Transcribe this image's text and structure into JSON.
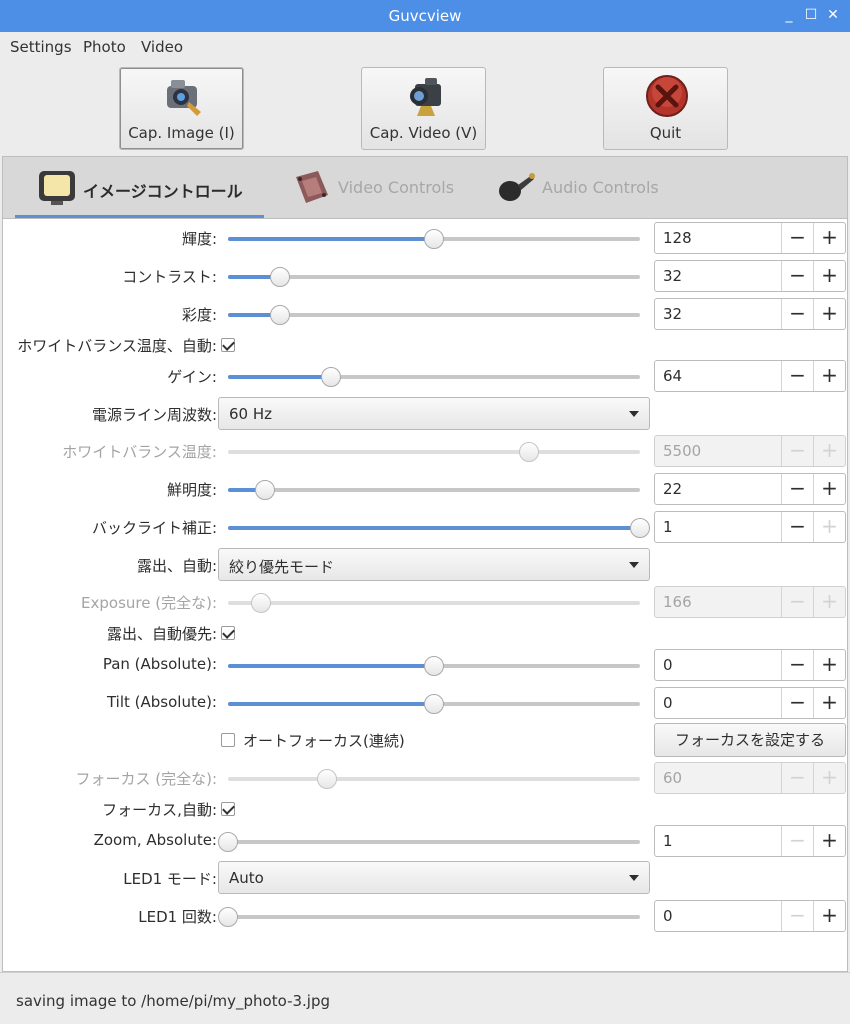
{
  "window": {
    "title": "Guvcview",
    "minimize": "_",
    "maximize": "☐",
    "close": "✕"
  },
  "menu": {
    "settings": "Settings",
    "photo": "Photo",
    "video": "Video"
  },
  "toolbar": {
    "cap_image": {
      "label": "Cap. Image (I)",
      "icon": "camera-icon"
    },
    "cap_video": {
      "label": "Cap. Video (V)",
      "icon": "video-camera-icon"
    },
    "quit": {
      "label": "Quit",
      "icon": "quit-x-icon"
    }
  },
  "tabs": [
    {
      "label": "イメージコントロール",
      "icon": "monitor-icon",
      "active": true
    },
    {
      "label": "Video Controls",
      "icon": "film-icon",
      "active": false
    },
    {
      "label": "Audio Controls",
      "icon": "microphone-icon",
      "active": false
    }
  ],
  "controls": {
    "brightness": {
      "label": "輝度:",
      "value": "128",
      "level": 0.5
    },
    "contrast": {
      "label": "コントラスト:",
      "value": "32",
      "level": 0.125
    },
    "saturation": {
      "label": "彩度:",
      "value": "32",
      "level": 0.125
    },
    "wb_auto": {
      "label": "ホワイトバランス温度、自動:",
      "checked": true
    },
    "gain": {
      "label": "ゲイン:",
      "value": "64",
      "level": 0.25
    },
    "power_line": {
      "label": "電源ライン周波数:",
      "value": "60 Hz"
    },
    "wb_temp": {
      "label": "ホワイトバランス温度:",
      "value": "5500",
      "level": 0.73
    },
    "sharpness": {
      "label": "鮮明度:",
      "value": "22",
      "level": 0.09
    },
    "backlight": {
      "label": "バックライト補正:",
      "value": "1",
      "level": 1.0
    },
    "exposure_auto": {
      "label": "露出、自動:",
      "value": "絞り優先モード"
    },
    "exposure_abs": {
      "label": "Exposure (完全な):",
      "value": "166",
      "level": 0.08
    },
    "exposure_priority": {
      "label": "露出、自動優先:",
      "checked": true
    },
    "pan": {
      "label": "Pan (Absolute):",
      "value": "0",
      "level": 0.5
    },
    "tilt": {
      "label": "Tilt (Absolute):",
      "value": "0",
      "level": 0.5
    },
    "autofocus_cont": {
      "label": "オートフォーカス(連続)",
      "checked": false
    },
    "set_focus": {
      "label": "フォーカスを設定する"
    },
    "focus_abs": {
      "label": "フォーカス (完全な):",
      "value": "60",
      "level": 0.24
    },
    "focus_auto": {
      "label": "フォーカス,自動:",
      "checked": true
    },
    "zoom": {
      "label": "Zoom, Absolute:",
      "value": "1",
      "level": 0.0
    },
    "led1_mode": {
      "label": "LED1 モード:",
      "value": "Auto"
    },
    "led1_freq": {
      "label": "LED1 回数:",
      "value": "0",
      "level": 0.0
    }
  },
  "spin": {
    "minus": "−",
    "plus": "+"
  },
  "status": {
    "text": "saving image to /home/pi/my_photo-3.jpg"
  }
}
